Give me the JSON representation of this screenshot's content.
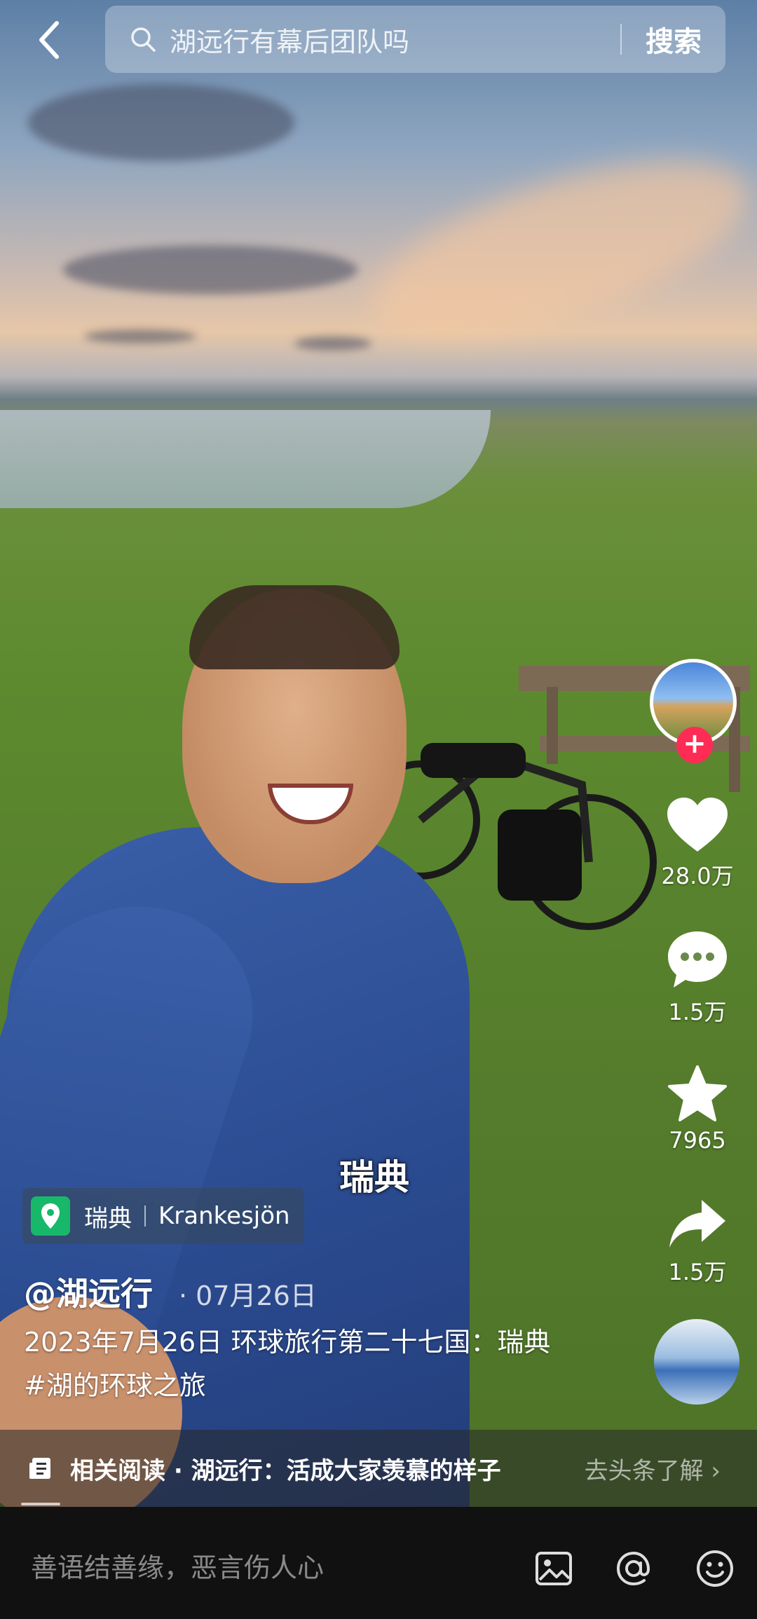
{
  "search": {
    "query": "湖远行有幕后团队吗",
    "button": "搜索"
  },
  "rail": {
    "likes": "28.0万",
    "comments": "1.5万",
    "favorites": "7965",
    "shares": "1.5万",
    "follow": "+"
  },
  "video": {
    "subtitle": "瑞典"
  },
  "location": {
    "country": "瑞典",
    "place": "Krankesjön"
  },
  "post": {
    "author": "@湖远行",
    "date": "· 07月26日",
    "line1": "2023年7月26日 环球旅行第二十七国：瑞典",
    "line2": "#湖的环球之旅"
  },
  "related": {
    "text": "相关阅读 · 湖远行：活成大家羡慕的样子",
    "link": "去头条了解 ›"
  },
  "comment_bar": {
    "placeholder": "善语结善缘，恶言伤人心"
  },
  "colors": {
    "accent": "#fe2c55",
    "location_pin": "#18b86a"
  },
  "icons": [
    "back-icon",
    "search-icon",
    "heart-icon",
    "comment-icon",
    "star-icon",
    "share-icon",
    "location-pin-icon",
    "article-icon",
    "image-icon",
    "at-icon",
    "emoji-icon"
  ]
}
